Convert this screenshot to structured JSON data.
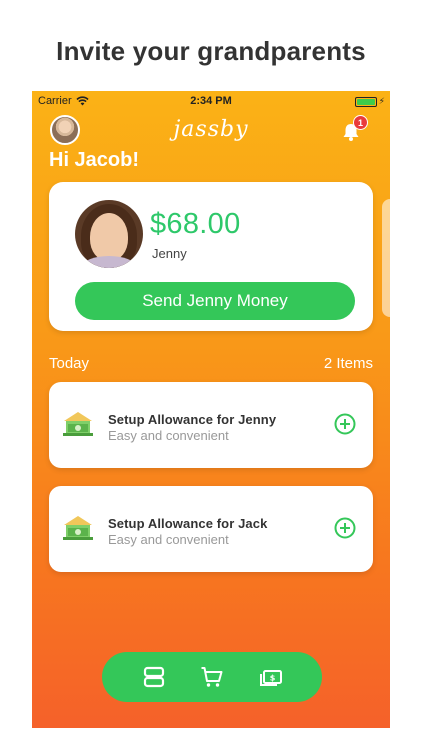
{
  "headline": "Invite your grandparents",
  "statusbar": {
    "carrier": "Carrier",
    "time": "2:34 PM"
  },
  "header": {
    "logo": "jassby",
    "notification_count": "1",
    "greeting": "Hi Jacob!"
  },
  "balance_card": {
    "amount": "$68.00",
    "kid_name": "Jenny",
    "send_label": "Send Jenny Money"
  },
  "section": {
    "title": "Today",
    "count": "2 Items"
  },
  "tasks": [
    {
      "title": "Setup Allowance for Jenny",
      "subtitle": "Easy and convenient"
    },
    {
      "title": "Setup Allowance for Jack",
      "subtitle": "Easy and convenient"
    }
  ],
  "tabs": [
    {
      "icon": "cards-icon"
    },
    {
      "icon": "cart-icon"
    },
    {
      "icon": "money-icon"
    }
  ],
  "colors": {
    "accent_green": "#34c759",
    "amount_green": "#2ec86a",
    "gradient_top": "#fbb216",
    "gradient_bottom": "#f5612a",
    "badge_red": "#e93b3b"
  }
}
